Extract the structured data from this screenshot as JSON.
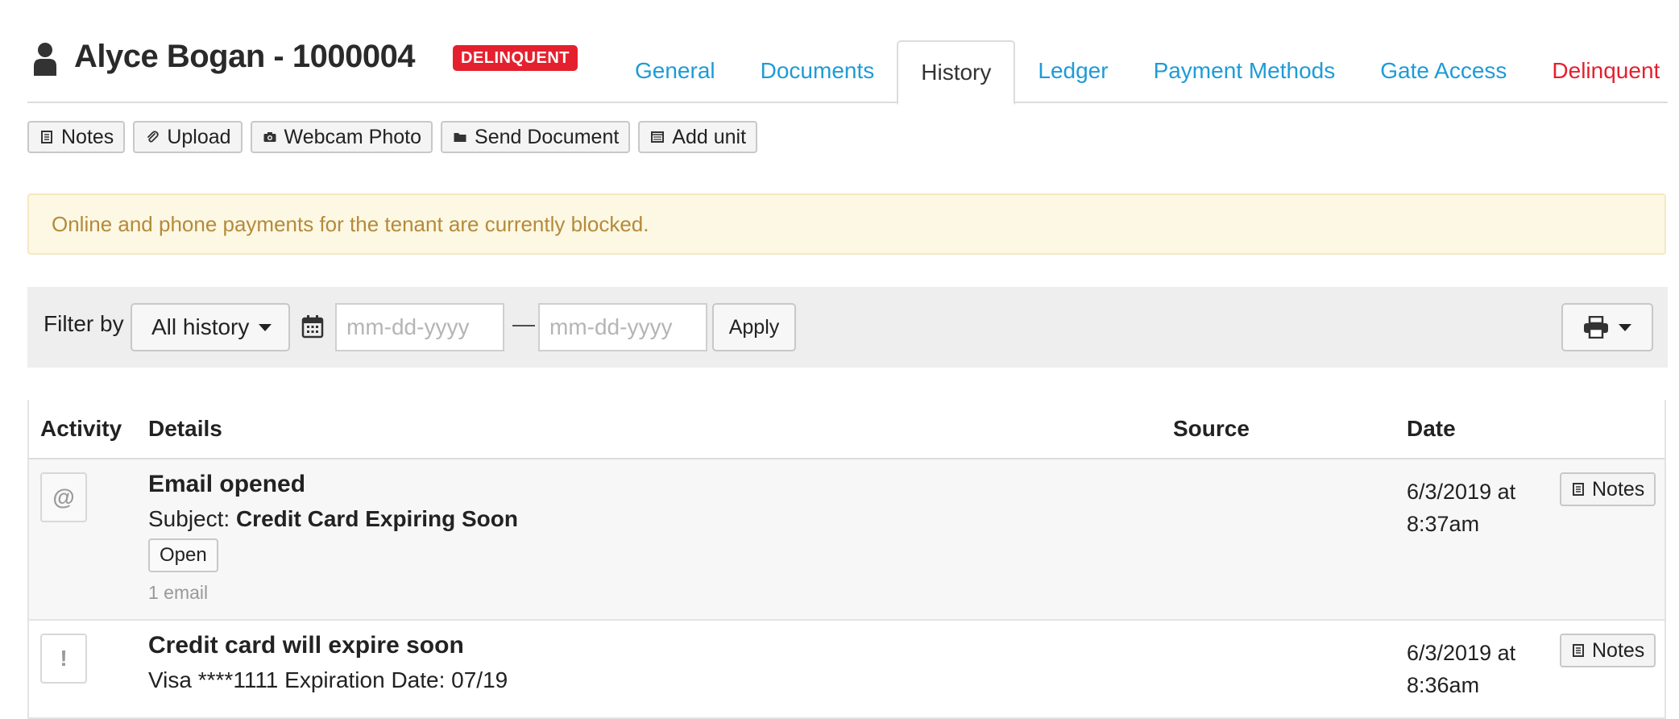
{
  "header": {
    "tenant_name": "Alyce Bogan - 1000004",
    "status_badge": "DELINQUENT"
  },
  "tabs": [
    {
      "label": "General"
    },
    {
      "label": "Documents"
    },
    {
      "label": "History",
      "active": true
    },
    {
      "label": "Ledger"
    },
    {
      "label": "Payment Methods"
    },
    {
      "label": "Gate Access"
    },
    {
      "label": "Delinquent",
      "color": "#e5202e"
    }
  ],
  "toolbar": {
    "notes": "Notes",
    "upload": "Upload",
    "webcam_photo": "Webcam Photo",
    "send_document": "Send Document",
    "add_unit": "Add unit"
  },
  "alert": {
    "message": "Online and phone payments for the tenant are currently blocked."
  },
  "filter": {
    "label": "Filter by",
    "selected": "All history",
    "start_placeholder": "mm-dd-yyyy",
    "end_placeholder": "mm-dd-yyyy",
    "separator": "—",
    "apply": "Apply"
  },
  "table": {
    "columns": {
      "activity": "Activity",
      "details": "Details",
      "source": "Source",
      "date": "Date"
    },
    "rows": [
      {
        "icon": "@",
        "title": "Email opened",
        "subject_prefix": "Subject: ",
        "subject": "Credit Card Expiring Soon",
        "open_button": "Open",
        "count": "1 email",
        "date_line1": "6/3/2019 at",
        "date_line2": "8:37am",
        "notes_button": "Notes"
      },
      {
        "icon": "!",
        "title": "Credit card will expire soon",
        "detail": "Visa ****1111 Expiration Date: 07/19",
        "date_line1": "6/3/2019 at",
        "date_line2": "8:36am",
        "notes_button": "Notes"
      }
    ]
  },
  "colors": {
    "link": "#1e9bd7",
    "danger": "#e5202e",
    "alert_text": "#b58a3b",
    "alert_bg": "#fcf8e3"
  }
}
